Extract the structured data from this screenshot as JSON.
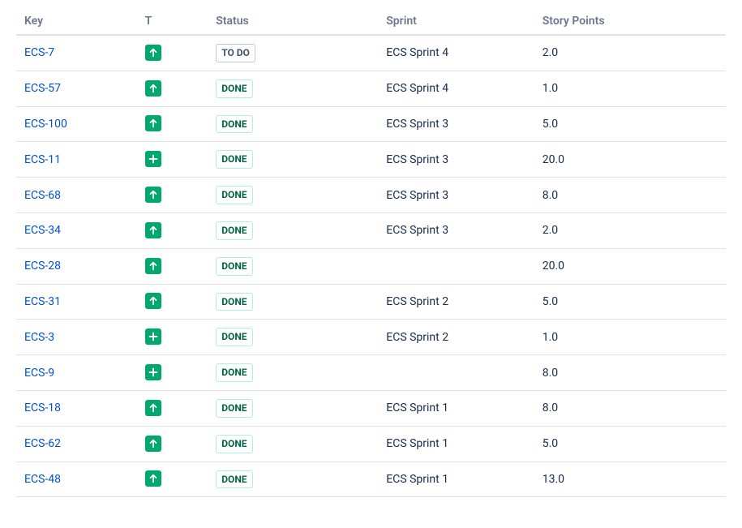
{
  "columns": {
    "key": "Key",
    "type": "T",
    "status": "Status",
    "sprint": "Sprint",
    "points": "Story Points"
  },
  "statusLabels": {
    "todo": "TO DO",
    "done": "DONE"
  },
  "rows": [
    {
      "key": "ECS-7",
      "type": "improvement",
      "status": "todo",
      "sprint": "ECS Sprint 4",
      "points": "2.0"
    },
    {
      "key": "ECS-57",
      "type": "improvement",
      "status": "done",
      "sprint": "ECS Sprint 4",
      "points": "1.0"
    },
    {
      "key": "ECS-100",
      "type": "improvement",
      "status": "done",
      "sprint": "ECS Sprint 3",
      "points": "5.0"
    },
    {
      "key": "ECS-11",
      "type": "new-feature",
      "status": "done",
      "sprint": "ECS Sprint 3",
      "points": "20.0"
    },
    {
      "key": "ECS-68",
      "type": "improvement",
      "status": "done",
      "sprint": "ECS Sprint 3",
      "points": "8.0"
    },
    {
      "key": "ECS-34",
      "type": "improvement",
      "status": "done",
      "sprint": "ECS Sprint 3",
      "points": "2.0"
    },
    {
      "key": "ECS-28",
      "type": "improvement",
      "status": "done",
      "sprint": "",
      "points": "20.0"
    },
    {
      "key": "ECS-31",
      "type": "improvement",
      "status": "done",
      "sprint": "ECS Sprint 2",
      "points": "5.0"
    },
    {
      "key": "ECS-3",
      "type": "new-feature",
      "status": "done",
      "sprint": "ECS Sprint 2",
      "points": "1.0"
    },
    {
      "key": "ECS-9",
      "type": "new-feature",
      "status": "done",
      "sprint": "",
      "points": "8.0"
    },
    {
      "key": "ECS-18",
      "type": "improvement",
      "status": "done",
      "sprint": "ECS Sprint 1",
      "points": "8.0"
    },
    {
      "key": "ECS-62",
      "type": "improvement",
      "status": "done",
      "sprint": "ECS Sprint 1",
      "points": "5.0"
    },
    {
      "key": "ECS-48",
      "type": "improvement",
      "status": "done",
      "sprint": "ECS Sprint 1",
      "points": "13.0"
    }
  ]
}
